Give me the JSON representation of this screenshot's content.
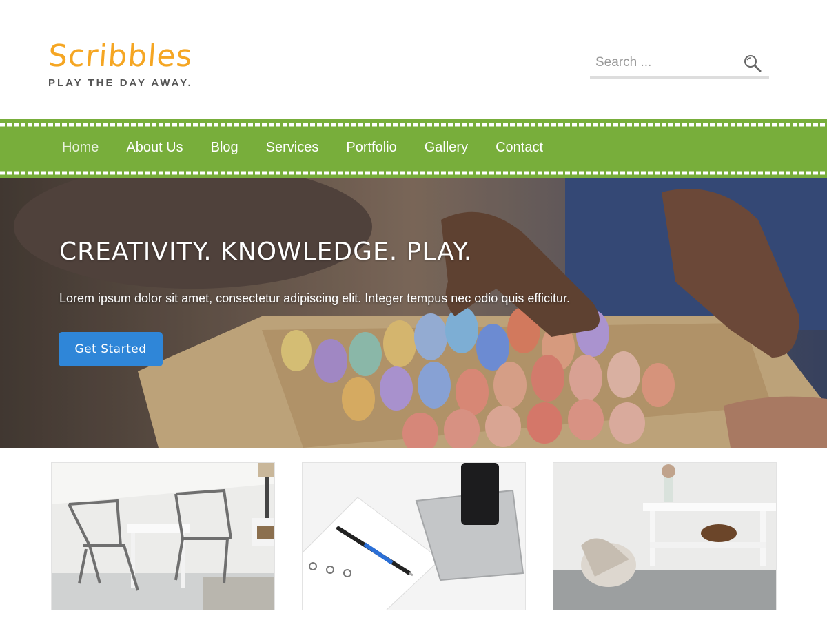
{
  "header": {
    "site_title": "Scribbles",
    "tagline": "PLAY THE DAY AWAY.",
    "search_placeholder": "Search ..."
  },
  "nav": {
    "items": [
      {
        "label": "Home",
        "active": true
      },
      {
        "label": "About Us"
      },
      {
        "label": "Blog"
      },
      {
        "label": "Services"
      },
      {
        "label": "Portfolio"
      },
      {
        "label": "Gallery"
      },
      {
        "label": "Contact"
      }
    ]
  },
  "hero": {
    "heading": "CREATIVITY. KNOWLEDGE. PLAY.",
    "text": "Lorem ipsum dolor sit amet, consectetur adipiscing elit. Integer tempus nec odio quis efficitur.",
    "button_label": "Get Started"
  },
  "colors": {
    "brand_orange": "#f5a623",
    "nav_green": "#78ae3b",
    "button_blue": "#2f86d8",
    "tagline_gray": "#555555"
  },
  "icons": {
    "search": "search-icon"
  }
}
